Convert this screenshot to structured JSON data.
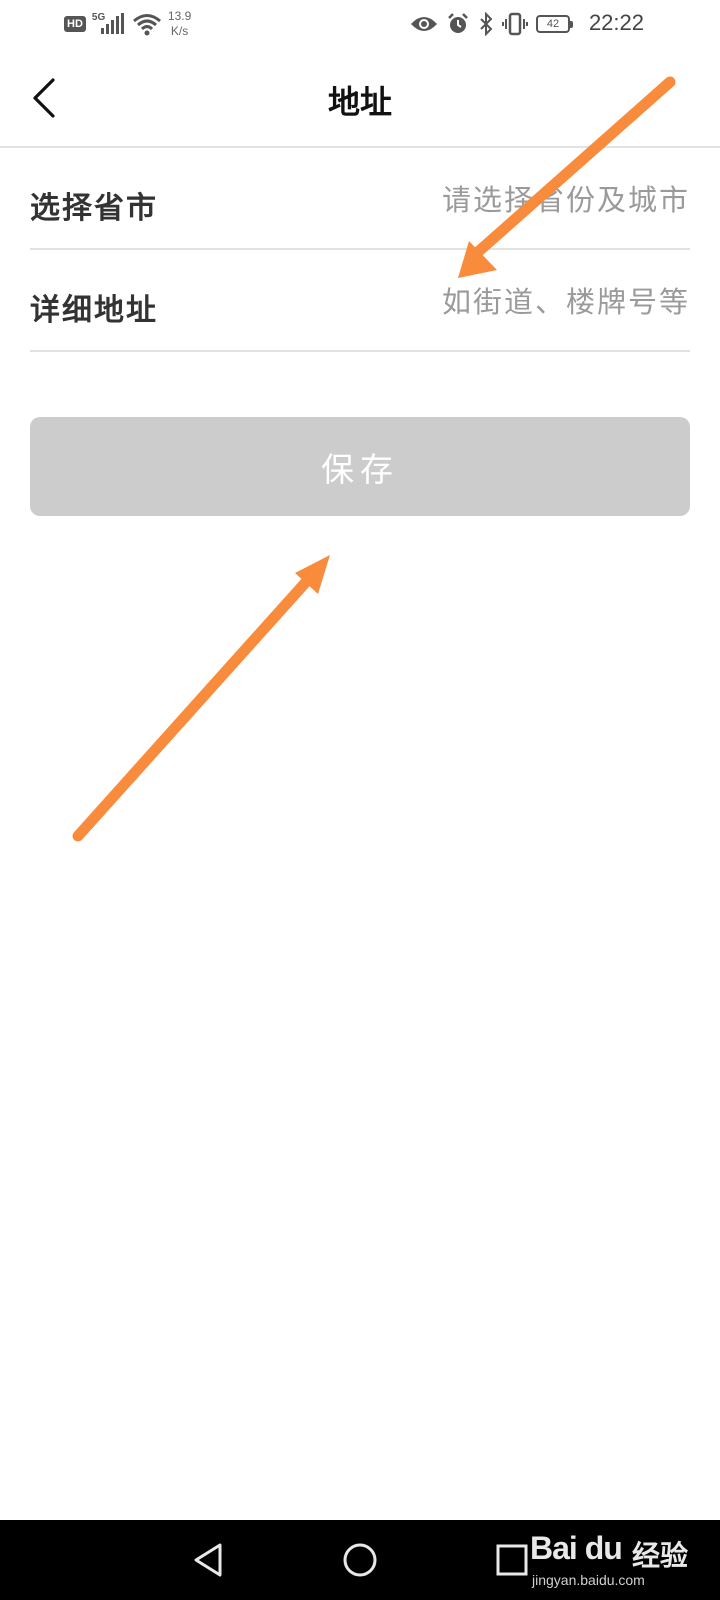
{
  "status_bar": {
    "hd_badge": "HD",
    "network_type": "5G",
    "speed_value": "13.9",
    "speed_unit": "K/s",
    "battery_level": "42",
    "time": "22:22",
    "icons": [
      "hd-icon",
      "signal-icon",
      "wifi-icon",
      "eye-icon",
      "alarm-icon",
      "bluetooth-icon",
      "vibrate-icon",
      "battery-icon"
    ]
  },
  "header": {
    "title": "地址",
    "back_icon": "chevron-left-icon"
  },
  "form": {
    "province_row": {
      "label": "选择省市",
      "placeholder": "请选择省份及城市",
      "value": ""
    },
    "detail_row": {
      "label": "详细地址",
      "placeholder": "如街道、楼牌号等",
      "value": ""
    }
  },
  "save_button": {
    "label": "保存",
    "enabled": false
  },
  "colors": {
    "arrow": "#f98b3c",
    "button_disabled_bg": "#cccccc",
    "placeholder": "#9a9a9a",
    "divider": "#e2e2e2"
  },
  "nav_bar": {
    "icons": [
      "back-triangle-icon",
      "home-circle-icon",
      "recents-square-icon"
    ]
  },
  "watermark": {
    "logo_text": "Bai du",
    "brand_text": "经验",
    "url": "jingyan.baidu.com"
  }
}
